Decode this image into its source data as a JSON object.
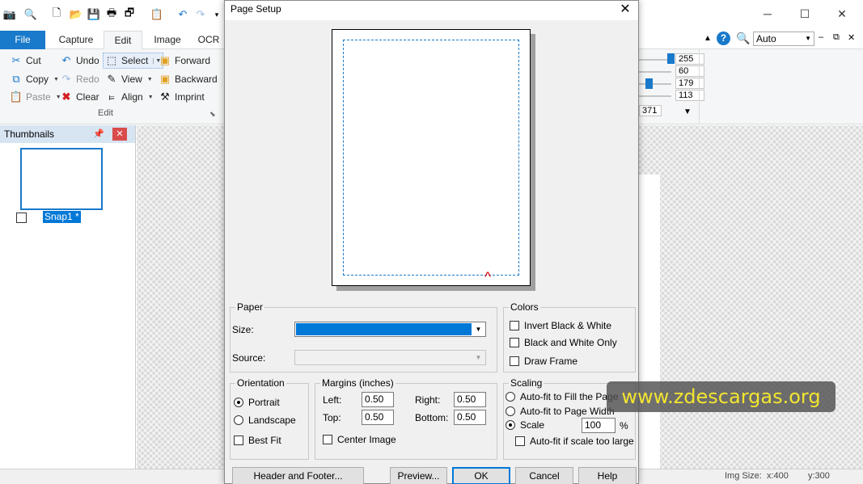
{
  "app": {
    "tabs": [
      "File",
      "Capture",
      "Edit",
      "Image",
      "OCR"
    ],
    "active_tab": "Edit",
    "zoom_select": "Auto",
    "ribbon": {
      "cut": "Cut",
      "copy": "Copy",
      "paste": "Paste",
      "undo": "Undo",
      "redo": "Redo",
      "clear": "Clear",
      "select": "Select",
      "view": "View",
      "align": "Align",
      "forward": "Forward",
      "backward": "Backward",
      "imprint": "Imprint",
      "group_label": "Edit"
    },
    "color_values": [
      "255",
      "60",
      "179",
      "113"
    ],
    "partial_value": "371",
    "thumbnails": {
      "title": "Thumbnails",
      "item_label": "Snap1 *"
    },
    "status": {
      "img_size_label": "Img Size:",
      "x": "x:400",
      "y": "y:300"
    }
  },
  "dialog": {
    "title": "Page Setup",
    "paper": {
      "legend": "Paper",
      "size_label": "Size:",
      "source_label": "Source:"
    },
    "colors": {
      "legend": "Colors",
      "invert": "Invert Black & White",
      "bw_only": "Black and White Only",
      "draw_frame": "Draw Frame"
    },
    "orientation": {
      "legend": "Orientation",
      "portrait": "Portrait",
      "landscape": "Landscape",
      "best_fit": "Best Fit",
      "selected": "Portrait"
    },
    "margins": {
      "legend": "Margins (inches)",
      "left_label": "Left:",
      "left": "0.50",
      "right_label": "Right:",
      "right": "0.50",
      "top_label": "Top:",
      "top": "0.50",
      "bottom_label": "Bottom:",
      "bottom": "0.50",
      "center_image": "Center Image"
    },
    "scaling": {
      "legend": "Scaling",
      "fill_page": "Auto-fit to Fill the Page",
      "page_width": "Auto-fit to Page Width",
      "scale": "Scale",
      "scale_value": "100",
      "percent": "%",
      "autofit_large": "Auto-fit if scale too large",
      "selected": "Scale"
    },
    "buttons": {
      "header_footer": "Header and Footer...",
      "preview": "Preview...",
      "ok": "OK",
      "cancel": "Cancel",
      "help": "Help"
    }
  },
  "watermark": "www.zdescargas.org",
  "colors": {
    "accent": "#1979ca",
    "selection": "#0078d7",
    "close_red": "#d94c4c",
    "watermark_text": "#f2e530"
  }
}
